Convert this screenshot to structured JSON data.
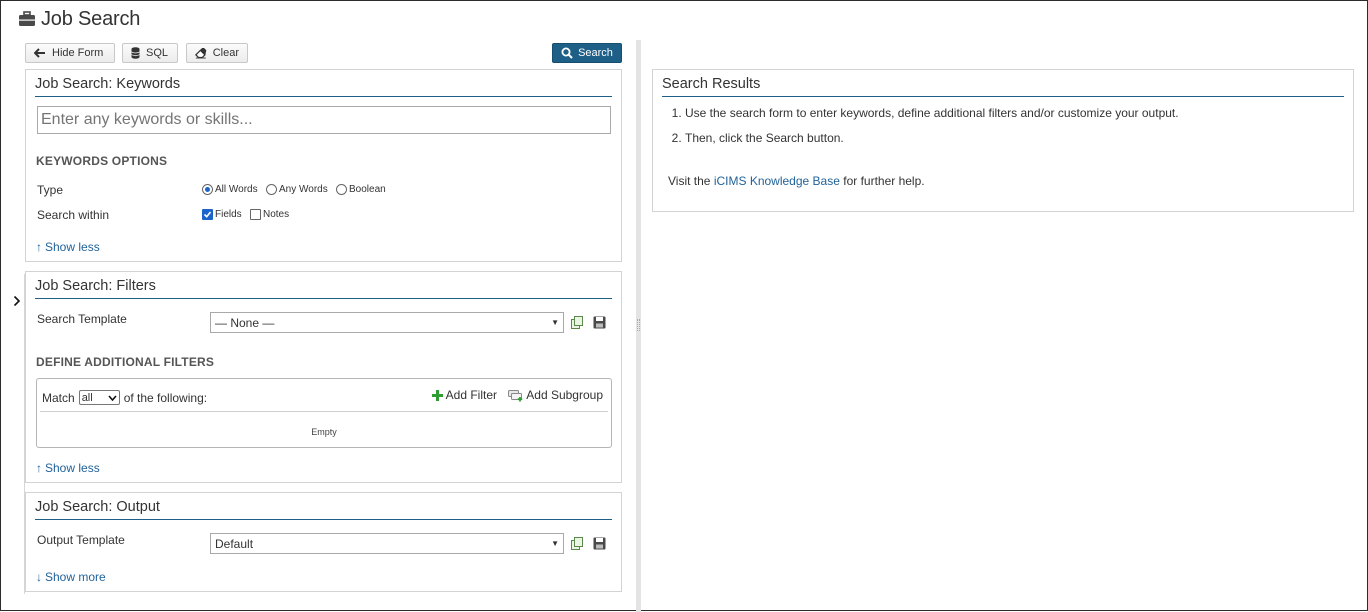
{
  "page": {
    "title": "Job Search"
  },
  "toolbar": {
    "hide_form_label": "Hide Form",
    "sql_label": "SQL",
    "clear_label": "Clear",
    "search_label": "Search"
  },
  "keywords_panel": {
    "title": "Job Search: Keywords",
    "input_placeholder": "Enter any keywords or skills...",
    "options_heading": "KEYWORDS OPTIONS",
    "type_label": "Type",
    "type_options": [
      {
        "label": "All Words",
        "selected": true
      },
      {
        "label": "Any Words",
        "selected": false
      },
      {
        "label": "Boolean",
        "selected": false
      }
    ],
    "search_within_label": "Search within",
    "search_within_options": [
      {
        "label": "Fields",
        "checked": true
      },
      {
        "label": "Notes",
        "checked": false
      }
    ],
    "toggle_link": "Show less"
  },
  "filters_panel": {
    "title": "Job Search: Filters",
    "template_label": "Search Template",
    "template_value": "— None —",
    "additional_heading": "DEFINE ADDITIONAL FILTERS",
    "match_prefix": "Match",
    "match_value": "all",
    "match_suffix": "of the following:",
    "add_filter_label": "Add Filter",
    "add_subgroup_label": "Add Subgroup",
    "empty_text": "Empty",
    "toggle_link": "Show less"
  },
  "output_panel": {
    "title": "Job Search: Output",
    "template_label": "Output Template",
    "template_value": "Default",
    "toggle_link": "Show more"
  },
  "results_panel": {
    "title": "Search Results",
    "steps": [
      "Use the search form to enter keywords, define additional filters and/or customize your output.",
      "Then, click the Search button."
    ],
    "help_prefix": "Visit the",
    "help_link": "iCIMS Knowledge Base",
    "help_suffix": "for further help."
  },
  "colors": {
    "accent": "#1d5f86",
    "link": "#22639a",
    "check_blue": "#1c64c9",
    "add_green": "#2e9e33"
  }
}
